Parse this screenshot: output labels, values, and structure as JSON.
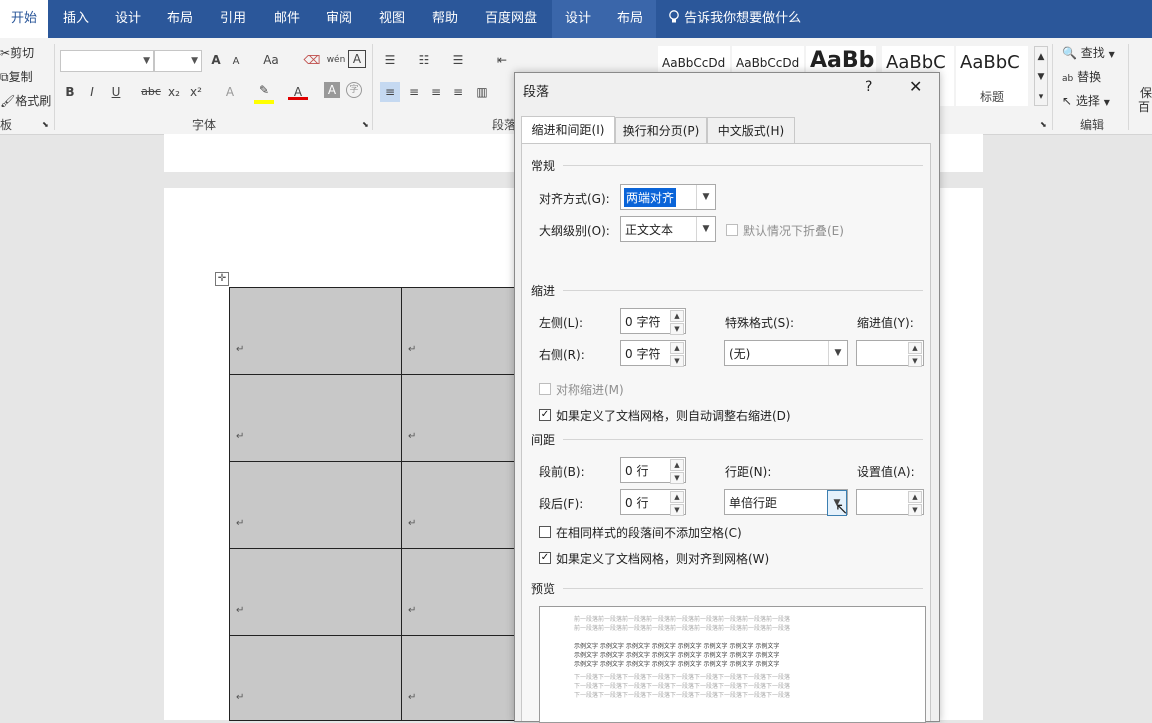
{
  "menu": {
    "tabs": [
      "开始",
      "插入",
      "设计",
      "布局",
      "引用",
      "邮件",
      "审阅",
      "视图",
      "帮助",
      "百度网盘",
      "设计",
      "布局"
    ],
    "tell_me": "告诉我你想要做什么"
  },
  "ribbon": {
    "clipboard": {
      "cut": "剪切",
      "copy": "复制",
      "format_painter": "格式刷",
      "group_label": "板"
    },
    "font": {
      "group_label": "字体",
      "bold": "B",
      "italic": "I",
      "underline": "U",
      "strike": "abc",
      "sub": "x₂",
      "sup": "x²",
      "grow": "A",
      "shrink": "A",
      "case": "Aa",
      "color_a": "A",
      "highlight_a": "A",
      "box_a": "A",
      "char_a": "A",
      "phon": "wén"
    },
    "paragraph": {
      "group_label": "段落"
    },
    "styles": [
      {
        "sample": "AaBbCcDd",
        "name": ""
      },
      {
        "sample": "AaBbCcDd",
        "name": ""
      },
      {
        "sample": "AaBb",
        "name": ""
      },
      {
        "sample": "AaBbC",
        "name": ""
      },
      {
        "sample": "AaBbC",
        "name": "标题"
      }
    ],
    "editing": {
      "find": "查找",
      "replace": "替换",
      "select": "选择",
      "group_label": "编辑"
    },
    "right_cut": {
      "line1": "保",
      "line2": "百"
    }
  },
  "document": {
    "para_mark": "↵"
  },
  "dialog": {
    "title": "段落",
    "help": "?",
    "close": "✕",
    "tabs": [
      "缩进和间距(I)",
      "换行和分页(P)",
      "中文版式(H)"
    ],
    "general": {
      "title": "常规",
      "alignment_label": "对齐方式(G):",
      "alignment_value": "两端对齐",
      "outline_label": "大纲级别(O):",
      "outline_value": "正文文本",
      "collapse_label": "默认情况下折叠(E)"
    },
    "indent": {
      "title": "缩进",
      "left_label": "左侧(L):",
      "left_value": "0 字符",
      "right_label": "右侧(R):",
      "right_value": "0 字符",
      "special_label": "特殊格式(S):",
      "special_value": "(无)",
      "by_label": "缩进值(Y):",
      "by_value": "",
      "mirror_label": "对称缩进(M)",
      "auto_adjust_label": "如果定义了文档网格，则自动调整右缩进(D)"
    },
    "spacing": {
      "title": "间距",
      "before_label": "段前(B):",
      "before_value": "0 行",
      "after_label": "段后(F):",
      "after_value": "0 行",
      "line_label": "行距(N):",
      "line_value": "单倍行距",
      "at_label": "设置值(A):",
      "at_value": "",
      "no_space_label": "在相同样式的段落间不添加空格(C)",
      "snap_grid_label": "如果定义了文档网格，则对齐到网格(W)"
    },
    "preview": {
      "title": "预览",
      "prev_text": "前一段落前一段落前一段落前一段落前一段落前一段落前一段落前一段落前一段落",
      "sample_text": "示例文字 示例文字 示例文字 示例文字 示例文字 示例文字 示例文字 示例文字",
      "next_text": "下一段落下一段落下一段落下一段落下一段落下一段落下一段落下一段落下一段落"
    },
    "checks": {
      "auto_adjust": true,
      "snap_grid": true,
      "no_space": false,
      "mirror": false,
      "collapse": false
    }
  },
  "colors": {
    "menubar": "#2b579a",
    "ribbon": "#f3f3f3",
    "selection": "#0a64d8",
    "cell": "#c8c8c8"
  }
}
